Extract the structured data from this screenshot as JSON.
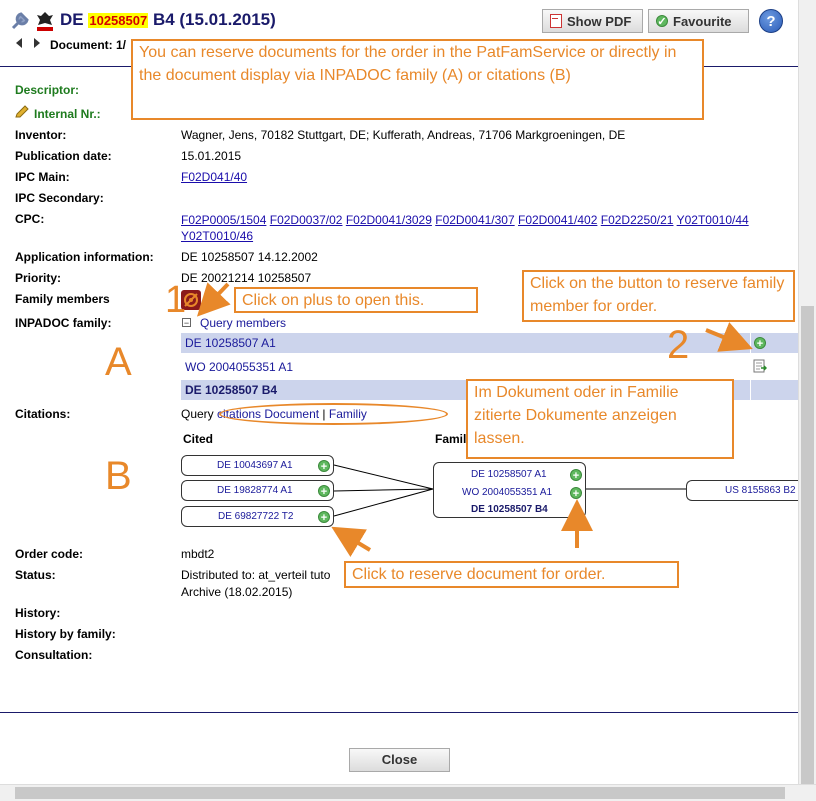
{
  "header": {
    "prefix": "DE",
    "number": "10258507",
    "suffix": "B4 (15.01.2015)",
    "document_label": "Document: 1/",
    "show_pdf": "Show PDF",
    "favourite": "Favourite",
    "help": "?"
  },
  "descriptor_label": "Descriptor:",
  "internal_label": "Internal Nr.:",
  "fields": {
    "inventor_label": "Inventor:",
    "inventor": "Wagner, Jens, 70182 Stuttgart, DE; Kufferath, Andreas, 71706 Markgroeningen, DE",
    "pubdate_label": "Publication date:",
    "pubdate": "15.01.2015",
    "ipc_main_label": "IPC Main:",
    "ipc_main": "F02D041/40",
    "ipc_sec_label": "IPC Secondary:",
    "cpc_label": "CPC:",
    "cpc": [
      "F02P0005/1504",
      "F02D0037/02",
      "F02D0041/3029",
      "F02D0041/307",
      "F02D0041/402",
      "F02D2250/21",
      "Y02T0010/44",
      "Y02T0010/46"
    ],
    "appinfo_label": "Application information:",
    "appinfo": "DE 10258507 14.12.2002",
    "priority_label": "Priority:",
    "priority": "DE 20021214 10258507",
    "family_label": "Family members",
    "inpadoc_label": "INPADOC family:",
    "query_members": "Query members",
    "inpadoc_rows": [
      "DE 10258507 A1",
      "WO 2004055351 A1",
      "DE 10258507 B4"
    ],
    "citations_label": "Citations:",
    "query": "Query",
    "citations_doc": "citations Document",
    "sep": "|",
    "family_link": "Familiy",
    "cited_head": "Cited",
    "family_head": "Famil",
    "cited": [
      "DE 10043697 A1",
      "DE 19828774 A1",
      "DE 69827722 T2"
    ],
    "family_nodes": [
      "DE 10258507 A1",
      "WO 2004055351 A1",
      "DE 10258507 B4"
    ],
    "citing": "US 8155863 B2",
    "order_label": "Order code:",
    "order": "mbdt2",
    "status_label": "Status:",
    "status1": "Distributed to: at_verteil tuto",
    "status2": "Archive (18.02.2015)",
    "history_label": "History:",
    "history_family_label": "History by family:",
    "consultation_label": "Consultation:"
  },
  "annotations": {
    "top": "You can reserve documents for the order in the PatFamService or directly in the document display via INPADOC family (A) or citations (B)",
    "plus": "Click on plus to open this.",
    "button": "Click on the button to reserve family member for order.",
    "dokument": "Im Dokument oder in Familie zitierte Dokumente anzeigen lassen.",
    "reserve": "Click to reserve document for order.",
    "num1": "1",
    "num2": "2",
    "A": "A",
    "B": "B"
  },
  "close": "Close",
  "colors": {
    "accent": "#e8882a",
    "row_highlight": "#ccd4ec",
    "highlight": "#ffff00",
    "number_red": "#d40000"
  }
}
